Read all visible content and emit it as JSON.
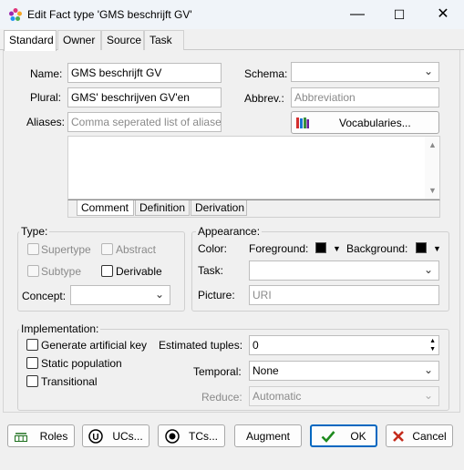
{
  "window": {
    "title": "Edit Fact type 'GMS beschrijft GV'",
    "minimize_glyph": "—",
    "maximize_glyph": "☐",
    "close_glyph": "✕"
  },
  "tabs": [
    "Standard",
    "Owner",
    "Source",
    "Task"
  ],
  "fields": {
    "name_label": "Name:",
    "name_value": "GMS beschrijft GV",
    "plural_label": "Plural:",
    "plural_value": "GMS' beschrijven GV'en",
    "aliases_label": "Aliases:",
    "aliases_placeholder": "Comma seperated list of aliases",
    "schema_label": "Schema:",
    "schema_value": "",
    "abbrev_label": "Abbrev.:",
    "abbrev_placeholder": "Abbreviation",
    "vocabularies_button": "Vocabularies..."
  },
  "memo_tabs": [
    "Comment",
    "Definition",
    "Derivation"
  ],
  "type_group": {
    "title": "Type:",
    "supertype": "Supertype",
    "abstract": "Abstract",
    "subtype": "Subtype",
    "derivable": "Derivable",
    "concept_label": "Concept:"
  },
  "appearance_group": {
    "title": "Appearance:",
    "color_label": "Color:",
    "foreground_label": "Foreground:",
    "background_label": "Background:",
    "foreground_color": "#000000",
    "background_color": "#000000",
    "task_label": "Task:",
    "picture_label": "Picture:",
    "picture_placeholder": "URI"
  },
  "implementation_group": {
    "title": "Implementation:",
    "generate_artificial_key": "Generate artificial key",
    "static_population": "Static population",
    "transitional": "Transitional",
    "estimated_tuples_label": "Estimated tuples:",
    "estimated_tuples_value": "0",
    "temporal_label": "Temporal:",
    "temporal_value": "None",
    "reduce_label": "Reduce:",
    "reduce_value": "Automatic"
  },
  "footer": {
    "roles": "Roles",
    "ucs": "UCs...",
    "tcs": "TCs...",
    "augment": "Augment",
    "ok": "OK",
    "cancel": "Cancel"
  },
  "colors": {
    "accent": "#0067c0",
    "ok_check": "#1e8a1e",
    "cancel_x": "#c42b1c"
  }
}
